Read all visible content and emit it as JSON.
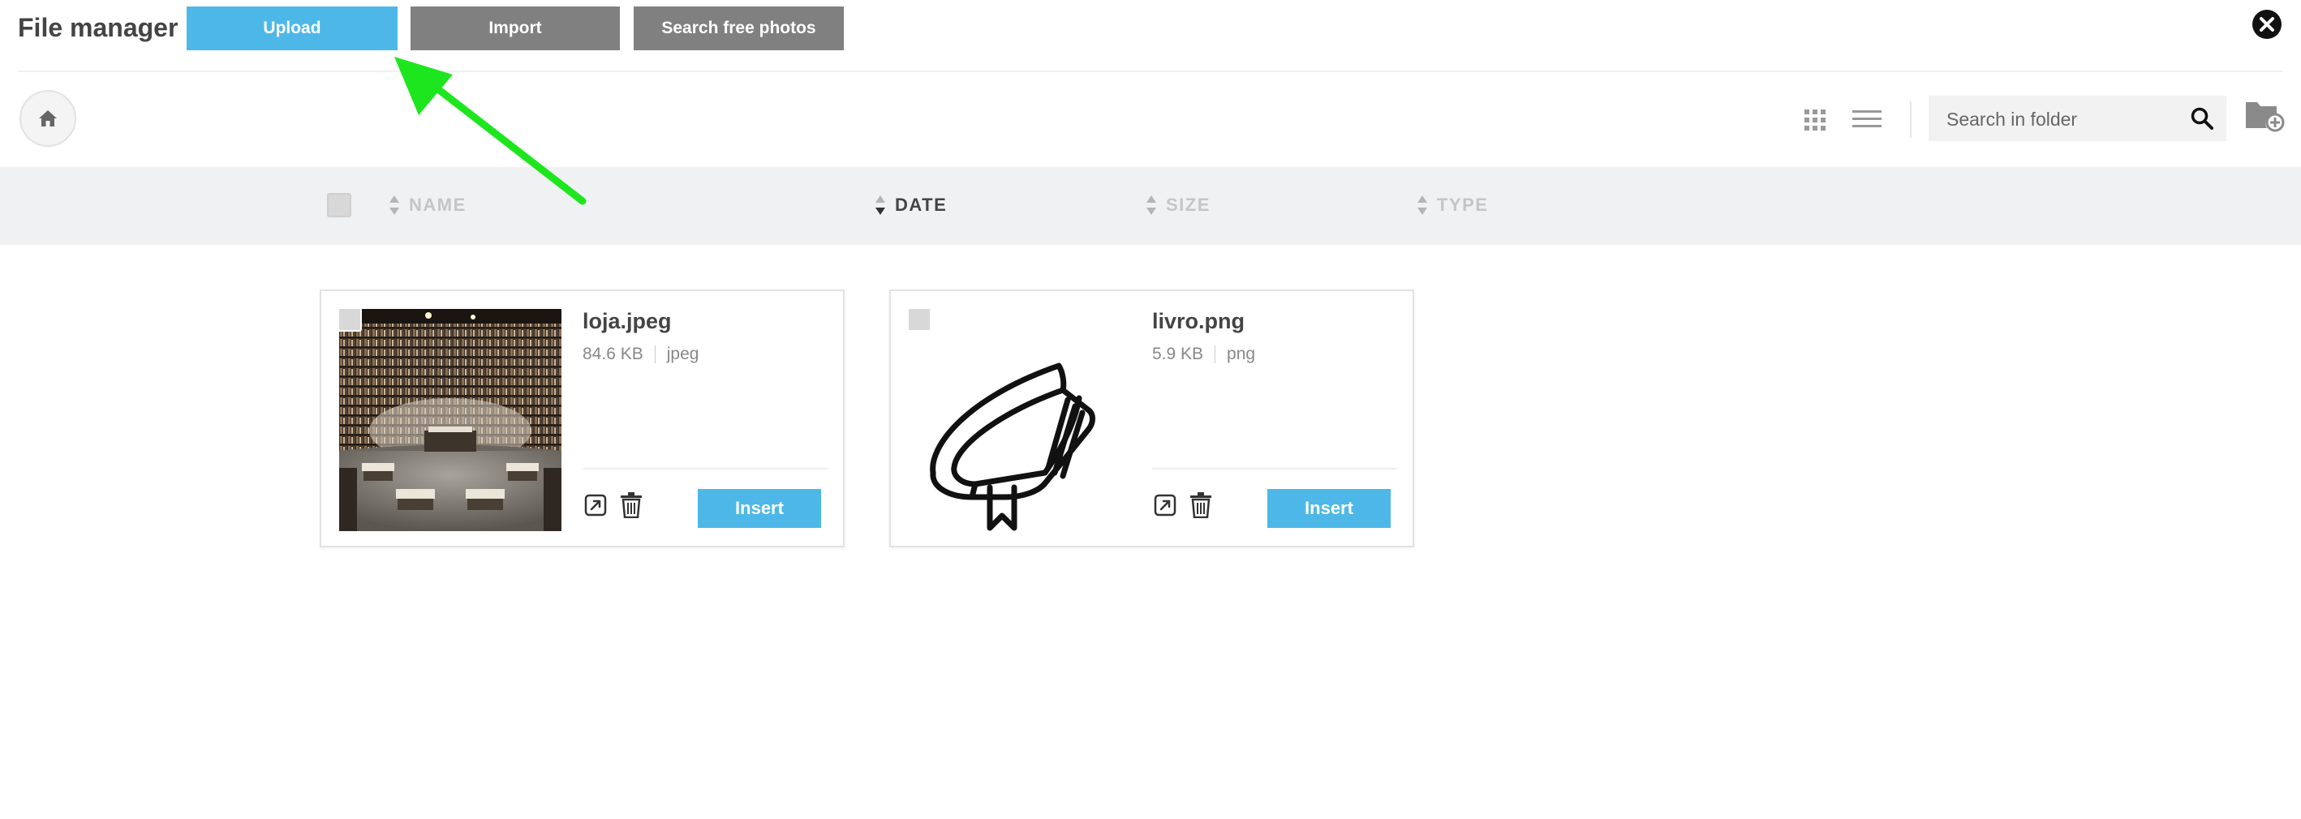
{
  "header": {
    "title": "File manager",
    "upload_label": "Upload",
    "import_label": "Import",
    "search_photos_label": "Search free photos"
  },
  "toolbar": {
    "search_placeholder": "Search in folder"
  },
  "sort": {
    "columns": [
      "NAME",
      "DATE",
      "SIZE",
      "TYPE"
    ],
    "active": "DATE"
  },
  "files": [
    {
      "name": "loja.jpeg",
      "size": "84.6 KB",
      "type": "jpeg",
      "insert_label": "Insert"
    },
    {
      "name": "livro.png",
      "size": "5.9 KB",
      "type": "png",
      "insert_label": "Insert"
    }
  ],
  "colors": {
    "primary": "#4db8e8",
    "secondary_button": "#808080",
    "sortbar_bg": "#f0f1f2",
    "annotation_arrow": "#1ee61e"
  },
  "icons": [
    "home-icon",
    "grid-view-icon",
    "list-view-icon",
    "search-icon",
    "folder-add-icon",
    "close-icon",
    "edit-icon",
    "trash-icon",
    "sort-arrows-icon",
    "book-icon"
  ]
}
